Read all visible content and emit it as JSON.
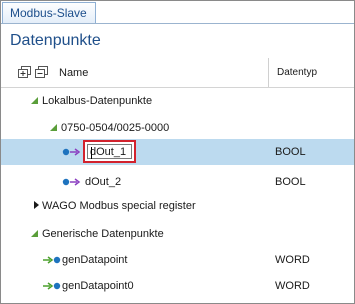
{
  "tab": {
    "label": "Modbus-Slave"
  },
  "page": {
    "title": "Datenpunkte"
  },
  "columns": {
    "name": "Name",
    "type": "Datentyp"
  },
  "tree": {
    "group_local": {
      "label": "Lokalbus-Datenpunkte"
    },
    "module": {
      "label": "0750-0504/0025-0000"
    },
    "dout1": {
      "label": "dOut_1",
      "type": "BOOL"
    },
    "dout2": {
      "label": "dOut_2",
      "type": "BOOL"
    },
    "group_wago": {
      "label": "WAGO Modbus special register"
    },
    "group_generic": {
      "label": "Generische Datenpunkte"
    },
    "gen1": {
      "label": "genDatapoint",
      "type": "WORD"
    },
    "gen2": {
      "label": "genDatapoint0",
      "type": "WORD"
    }
  },
  "icons": {
    "expand_all": "expand-all-icon",
    "collapse_all": "collapse-all-icon",
    "expanded": "expanded-triangle-icon",
    "collapsed": "collapsed-triangle-icon",
    "output": "output-datapoint-icon",
    "generic": "generic-datapoint-icon"
  },
  "colors": {
    "accent": "#1f4f8a",
    "selection": "#bcdaef",
    "edit_highlight": "#d2222d",
    "expand_triangle": "#5a9e3a",
    "dp_blue": "#1e73be",
    "dp_purple": "#8a3fc0",
    "dp_green": "#4aa02c"
  }
}
